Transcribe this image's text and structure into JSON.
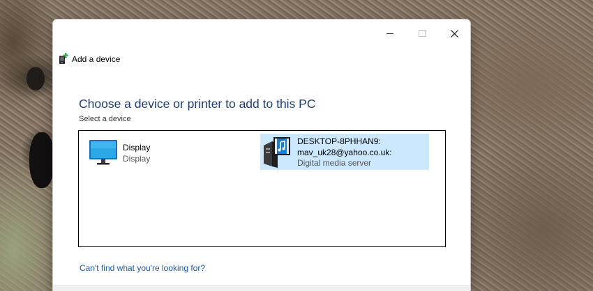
{
  "window": {
    "title": "Add a device",
    "icon": "add-device-icon",
    "caption_buttons": [
      "minimize-icon",
      "maximize-icon",
      "close-icon"
    ]
  },
  "main": {
    "heading": "Choose a device or printer to add to this PC",
    "subheading": "Select a device",
    "devices": [
      {
        "icon": "monitor-icon",
        "lines": [
          "Display",
          "Display"
        ],
        "selected": false
      },
      {
        "icon": "media-server-icon",
        "lines": [
          "DESKTOP-8PHHAN9:",
          "mav_uk28@yahoo.co.uk:",
          "Digital media server"
        ],
        "selected": true
      }
    ],
    "help_link": "Can't find what you're looking for?"
  },
  "colors": {
    "heading": "#1e3d78",
    "link": "#1a5aa8",
    "selection": "#cce8ff"
  }
}
